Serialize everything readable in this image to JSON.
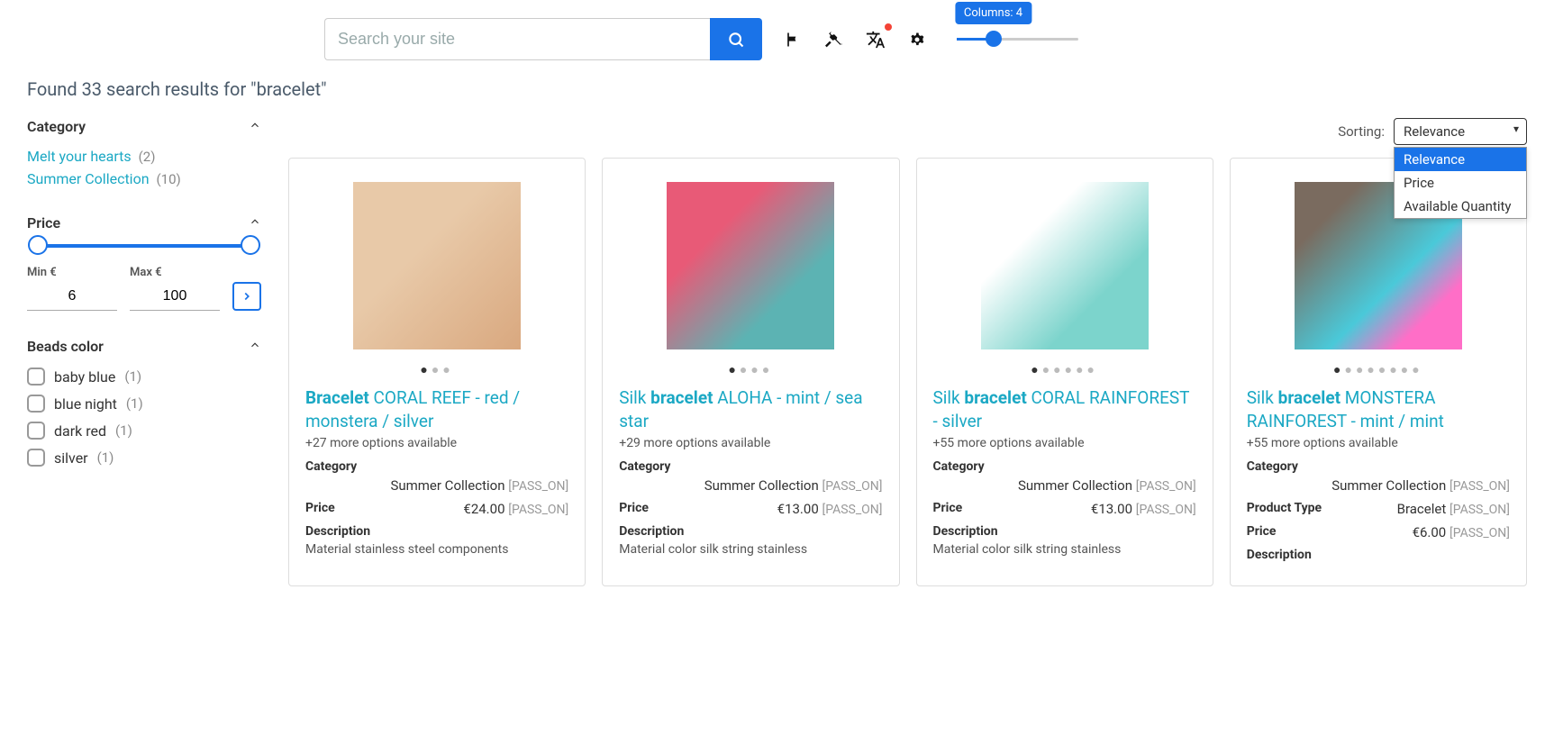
{
  "search": {
    "placeholder": "Search your site"
  },
  "slider_tooltip": "Columns: 4",
  "results_header": "Found 33 search results for \"bracelet\"",
  "facets": {
    "category": {
      "title": "Category",
      "items": [
        {
          "label": "Melt your hearts",
          "count": "(2)"
        },
        {
          "label": "Summer Collection",
          "count": "(10)"
        }
      ]
    },
    "price": {
      "title": "Price",
      "min_label": "Min €",
      "max_label": "Max €",
      "min_value": "6",
      "max_value": "100"
    },
    "beads": {
      "title": "Beads color",
      "items": [
        {
          "label": "baby blue",
          "count": "(1)"
        },
        {
          "label": "blue night",
          "count": "(1)"
        },
        {
          "label": "dark red",
          "count": "(1)"
        },
        {
          "label": "silver",
          "count": "(1)"
        }
      ]
    }
  },
  "sorting": {
    "label": "Sorting:",
    "selected": "Relevance",
    "options": [
      "Relevance",
      "Price",
      "Available Quantity"
    ]
  },
  "products": [
    {
      "title_hl": "Bracelet",
      "title_rest": " CORAL REEF - red / monstera / silver",
      "dots": 3,
      "more": "+27 more options available",
      "category_label": "Category",
      "category_val": "Summer Collection",
      "category_pass": "[PASS_ON]",
      "price_label": "Price",
      "price_val": "€24.00",
      "price_pass": "[PASS_ON]",
      "desc_label": "Description",
      "desc_text": "Material stainless steel components"
    },
    {
      "title_pre": "Silk ",
      "title_hl": "bracelet",
      "title_rest": " ALOHA - mint / sea star",
      "dots": 4,
      "more": "+29 more options available",
      "category_label": "Category",
      "category_val": "Summer Collection",
      "category_pass": "[PASS_ON]",
      "price_label": "Price",
      "price_val": "€13.00",
      "price_pass": "[PASS_ON]",
      "desc_label": "Description",
      "desc_text": "Material color silk string stainless"
    },
    {
      "title_pre": "Silk ",
      "title_hl": "bracelet",
      "title_rest": " CORAL RAINFOREST - silver",
      "dots": 6,
      "more": "+55 more options available",
      "category_label": "Category",
      "category_val": "Summer Collection",
      "category_pass": "[PASS_ON]",
      "price_label": "Price",
      "price_val": "€13.00",
      "price_pass": "[PASS_ON]",
      "desc_label": "Description",
      "desc_text": "Material color silk string stainless"
    },
    {
      "title_pre": "Silk ",
      "title_hl": "bracelet",
      "title_rest": " MONSTERA RAINFOREST - mint / mint",
      "dots": 8,
      "more": "+55 more options available",
      "category_label": "Category",
      "category_val": "Summer Collection",
      "category_pass": "[PASS_ON]",
      "pt_label": "Product Type",
      "pt_val": "Bracelet",
      "pt_pass": "[PASS_ON]",
      "price_label": "Price",
      "price_val": "€6.00",
      "price_pass": "[PASS_ON]",
      "desc_label": "Description"
    }
  ]
}
